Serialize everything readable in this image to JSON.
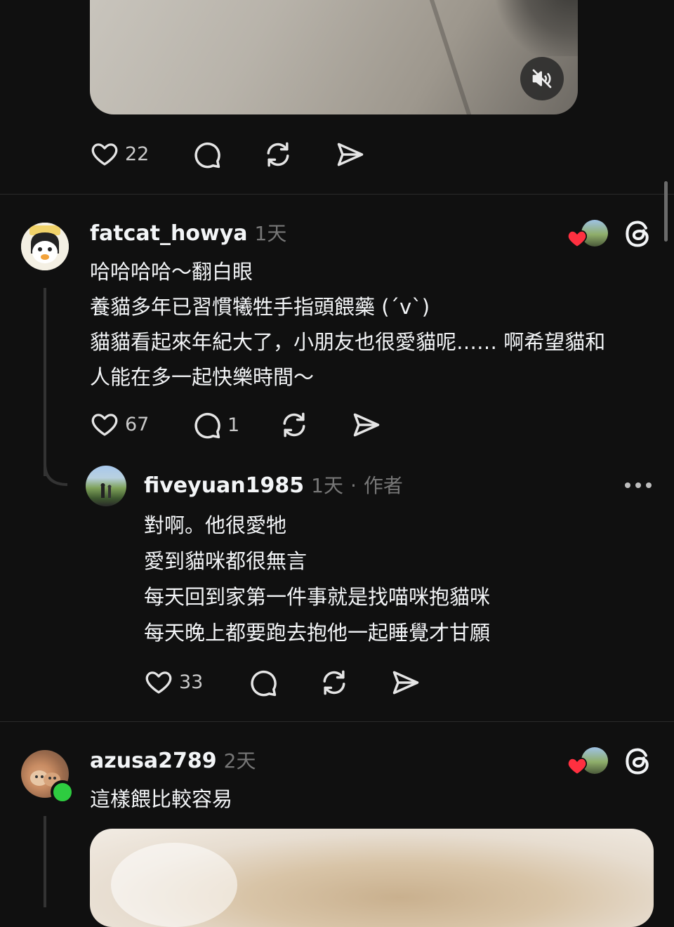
{
  "post": {
    "likes": "22"
  },
  "comments": [
    {
      "username": "fatcat_howya",
      "time": "1天",
      "lines": [
        "哈哈哈哈～翻白眼",
        "養貓多年已習慣犧牲手指頭餵藥 (´v`)",
        "貓貓看起來年紀大了，小朋友也很愛貓呢…… 啊希望貓和",
        "人能在多一起快樂時間～"
      ],
      "likes": "67",
      "replies": "1"
    },
    {
      "username": "fiveyuan1985",
      "time": "1天",
      "separator": "·",
      "role": "作者",
      "lines": [
        "對啊。他很愛牠",
        "愛到貓咪都很無言",
        "每天回到家第一件事就是找喵咪抱貓咪",
        "每天晚上都要跑去抱他一起睡覺才甘願"
      ],
      "likes": "33"
    },
    {
      "username": "azusa2789",
      "time": "2天",
      "lines": [
        "這樣餵比較容易"
      ]
    }
  ],
  "icons": {
    "like": "heart-icon",
    "reply": "comment-bubble-icon",
    "repost": "repost-icon",
    "share": "send-icon",
    "mute": "speaker-muted-icon",
    "threads": "threads-logo-icon",
    "more": "more-dots-icon",
    "liked_by_author": "liked-by-author-badge"
  },
  "colors": {
    "background": "#101010",
    "text": "#f3f5f7",
    "muted": "#777777",
    "heart": "#ff3040",
    "online": "#2ecc40"
  }
}
